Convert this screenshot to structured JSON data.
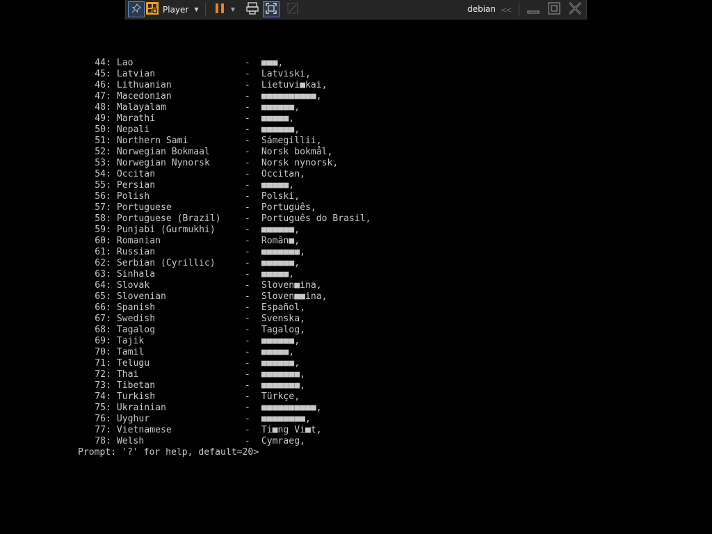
{
  "toolbar": {
    "player_label": "Player",
    "vm_name": "debian",
    "collapse_symbol": "<<",
    "accent": "#f07f1d"
  },
  "console": {
    "rows": [
      {
        "num": "44",
        "lang": "Lao",
        "native": "■■■,"
      },
      {
        "num": "45",
        "lang": "Latvian",
        "native": "Latviski,"
      },
      {
        "num": "46",
        "lang": "Lithuanian",
        "native": "Lietuvi■kai,"
      },
      {
        "num": "47",
        "lang": "Macedonian",
        "native": "■■■■■■■■■■,"
      },
      {
        "num": "48",
        "lang": "Malayalam",
        "native": "■■■■■■,"
      },
      {
        "num": "49",
        "lang": "Marathi",
        "native": "■■■■■,"
      },
      {
        "num": "50",
        "lang": "Nepali",
        "native": "■■■■■■,"
      },
      {
        "num": "51",
        "lang": "Northern Sami",
        "native": "Sámegillii,"
      },
      {
        "num": "52",
        "lang": "Norwegian Bokmaal",
        "native": "Norsk bokmål,"
      },
      {
        "num": "53",
        "lang": "Norwegian Nynorsk",
        "native": "Norsk nynorsk,"
      },
      {
        "num": "54",
        "lang": "Occitan",
        "native": "Occitan,"
      },
      {
        "num": "55",
        "lang": "Persian",
        "native": "■■■■■,"
      },
      {
        "num": "56",
        "lang": "Polish",
        "native": "Polski,"
      },
      {
        "num": "57",
        "lang": "Portuguese",
        "native": "Português,"
      },
      {
        "num": "58",
        "lang": "Portuguese (Brazil)",
        "native": "Português do Brasil,"
      },
      {
        "num": "59",
        "lang": "Punjabi (Gurmukhi)",
        "native": "■■■■■■,"
      },
      {
        "num": "60",
        "lang": "Romanian",
        "native": "Român■,"
      },
      {
        "num": "61",
        "lang": "Russian",
        "native": "■■■■■■■,"
      },
      {
        "num": "62",
        "lang": "Serbian (Cyrillic)",
        "native": "■■■■■■,"
      },
      {
        "num": "63",
        "lang": "Sinhala",
        "native": "■■■■■,"
      },
      {
        "num": "64",
        "lang": "Slovak",
        "native": "Sloven■ina,"
      },
      {
        "num": "65",
        "lang": "Slovenian",
        "native": "Sloven■■ina,"
      },
      {
        "num": "66",
        "lang": "Spanish",
        "native": "Español,"
      },
      {
        "num": "67",
        "lang": "Swedish",
        "native": "Svenska,"
      },
      {
        "num": "68",
        "lang": "Tagalog",
        "native": "Tagalog,"
      },
      {
        "num": "69",
        "lang": "Tajik",
        "native": "■■■■■■,"
      },
      {
        "num": "70",
        "lang": "Tamil",
        "native": "■■■■■,"
      },
      {
        "num": "71",
        "lang": "Telugu",
        "native": "■■■■■■,"
      },
      {
        "num": "72",
        "lang": "Thai",
        "native": "■■■■■■■,"
      },
      {
        "num": "73",
        "lang": "Tibetan",
        "native": "■■■■■■■,"
      },
      {
        "num": "74",
        "lang": "Turkish",
        "native": "Türkçe,"
      },
      {
        "num": "75",
        "lang": "Ukrainian",
        "native": "■■■■■■■■■■,"
      },
      {
        "num": "76",
        "lang": "Uyghur",
        "native": "■■■■■■■■,"
      },
      {
        "num": "77",
        "lang": "Vietnamese",
        "native": "Ti■ng Vi■t,"
      },
      {
        "num": "78",
        "lang": "Welsh",
        "native": "Cymraeg,"
      }
    ],
    "separator": "-",
    "prompt": "Prompt: '?' for help, default=20>"
  }
}
